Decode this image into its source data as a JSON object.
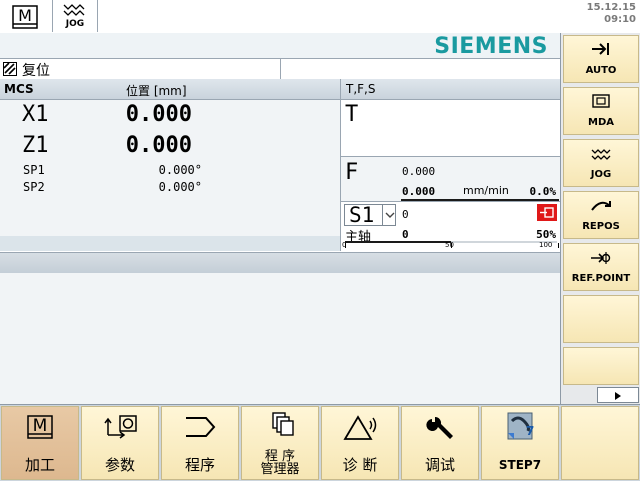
{
  "top": {
    "mode_m_label": "M",
    "mode_jog_label": "JOG",
    "date": "15.12.15",
    "time": "09:10"
  },
  "brand": "SIEMENS",
  "status": {
    "reset": "复位"
  },
  "mcs": {
    "header": "MCS",
    "position_header": "位置 [mm]",
    "axes": [
      {
        "name": "X1",
        "value": "0.000"
      },
      {
        "name": "Z1",
        "value": "0.000"
      }
    ],
    "spindles": [
      {
        "name": "SP1",
        "value": "0.000°"
      },
      {
        "name": "SP2",
        "value": "0.000°"
      }
    ]
  },
  "tfs": {
    "header": "T,F,S",
    "t_label": "T",
    "f_label": "F",
    "f_value1": "0.000",
    "f_value2": "0.000",
    "f_unit": "mm/min",
    "f_override": "0.0%",
    "s_label": "S1",
    "s_value": "0",
    "spindle_label": "主轴",
    "spindle_value": "0",
    "spindle_percent": "50%",
    "spindle_scale": [
      "0",
      "50",
      "100"
    ],
    "spindle_override": 0.5,
    "stop_color": "#e01818"
  },
  "right_softkeys": [
    {
      "label": "AUTO",
      "icon": "auto-icon"
    },
    {
      "label": "MDA",
      "icon": "mda-icon"
    },
    {
      "label": "JOG",
      "icon": "jog-icon"
    },
    {
      "label": "REPOS",
      "icon": "repos-icon"
    },
    {
      "label": "REF.POINT",
      "icon": "refpoint-icon"
    },
    {
      "label": ""
    },
    {
      "label": ""
    }
  ],
  "bottom_softkeys": [
    {
      "label": "加工",
      "icon": "machine-icon",
      "active": true
    },
    {
      "label": "参数",
      "icon": "parameter-icon"
    },
    {
      "label": "程序",
      "icon": "program-icon"
    },
    {
      "label": "程 序\n管理器",
      "icon": "program-manager-icon"
    },
    {
      "label": "诊 断",
      "icon": "diagnostics-icon"
    },
    {
      "label": "调试",
      "icon": "commissioning-icon"
    },
    {
      "label": "STEP7",
      "icon": "step7-icon"
    }
  ],
  "colors": {
    "brand": "#1a9aa0",
    "softkey": "#f6e6b4",
    "softkey_active": "#ddb88f",
    "panel": "#f1f4f6"
  }
}
